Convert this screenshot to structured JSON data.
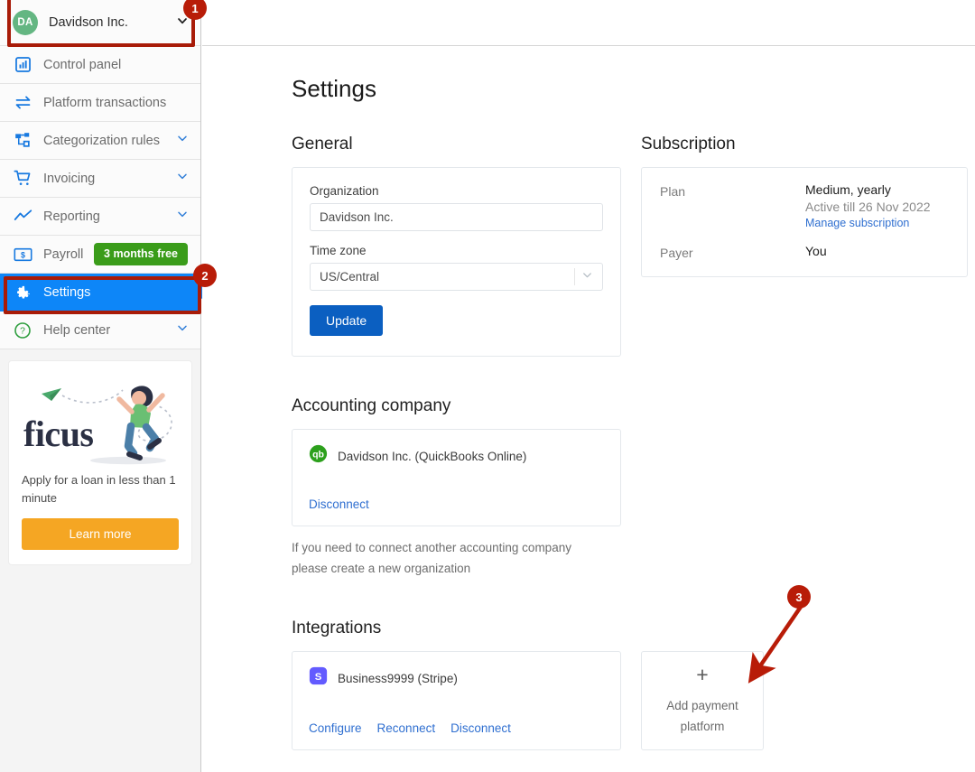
{
  "sidebar": {
    "org": {
      "initials": "DA",
      "name": "Davidson Inc."
    },
    "items": [
      {
        "label": "Control panel",
        "icon": "chart-bar-icon",
        "chevron": false,
        "badge": null
      },
      {
        "label": "Platform transactions",
        "icon": "transfer-arrows-icon",
        "chevron": false,
        "badge": null
      },
      {
        "label": "Categorization rules",
        "icon": "sitemap-icon",
        "chevron": true,
        "badge": null
      },
      {
        "label": "Invoicing",
        "icon": "shopping-cart-icon",
        "chevron": true,
        "badge": null
      },
      {
        "label": "Reporting",
        "icon": "line-chart-icon",
        "chevron": true,
        "badge": null
      },
      {
        "label": "Payroll",
        "icon": "money-note-icon",
        "chevron": false,
        "badge": "3 months free"
      },
      {
        "label": "Settings",
        "icon": "gear-icon",
        "chevron": false,
        "badge": null
      },
      {
        "label": "Help center",
        "icon": "question-circle-icon",
        "chevron": true,
        "badge": null
      }
    ],
    "promo": {
      "logo": "ficus",
      "text": "Apply for a loan in less than 1 minute",
      "button": "Learn more"
    }
  },
  "main": {
    "page_title": "Settings",
    "general": {
      "heading": "General",
      "organization_label": "Organization",
      "organization_value": "Davidson Inc.",
      "organization_placeholder": "Organization",
      "timezone_label": "Time zone",
      "timezone_value": "US/Central",
      "update_button": "Update"
    },
    "subscription": {
      "heading": "Subscription",
      "plan_label": "Plan",
      "plan_value": "Medium, yearly",
      "plan_active_till": "Active till 26 Nov 2022",
      "manage_link": "Manage subscription",
      "payer_label": "Payer",
      "payer_value": "You"
    },
    "accounting": {
      "heading": "Accounting company",
      "company_name": "Davidson Inc. (QuickBooks Online)",
      "company_icon": "quickbooks-icon",
      "disconnect_link": "Disconnect",
      "note": "If you need to connect another accounting company please create a new organization"
    },
    "integrations": {
      "heading": "Integrations",
      "platform_name": "Business9999 (Stripe)",
      "platform_icon": "stripe-icon",
      "links": [
        "Configure",
        "Reconnect",
        "Disconnect"
      ],
      "add_card": {
        "plus": "+",
        "label_line1": "Add payment",
        "label_line2": "platform"
      }
    }
  },
  "annotations": [
    {
      "number": "1",
      "target": "org-selector"
    },
    {
      "number": "2",
      "target": "sidebar-item-settings"
    },
    {
      "number": "3",
      "target": "add-payment-platform-card"
    }
  ],
  "colors": {
    "accent_blue": "#0d86f8",
    "primary_button": "#0b5fc1",
    "link_blue": "#2f6fd0",
    "badge_green": "#3a9c1a",
    "promo_orange": "#f5a623",
    "annotation_red": "#b81c08",
    "avatar_green": "#64b682",
    "quickbooks_green": "#2ca01c",
    "stripe_purple": "#635bff"
  }
}
